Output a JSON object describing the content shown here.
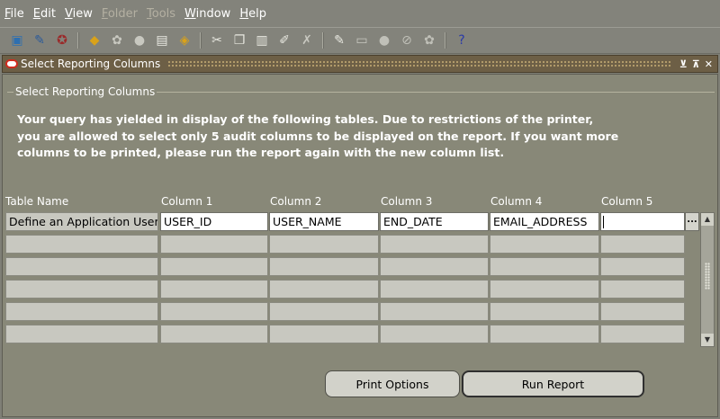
{
  "menubar": {
    "items": [
      {
        "ul": "F",
        "rest": "ile",
        "disabled": false
      },
      {
        "ul": "E",
        "rest": "dit",
        "disabled": false
      },
      {
        "ul": "V",
        "rest": "iew",
        "disabled": false
      },
      {
        "ul": "F",
        "rest": "older",
        "disabled": true
      },
      {
        "ul": "T",
        "rest": "ools",
        "disabled": true
      },
      {
        "ul": "W",
        "rest": "indow",
        "disabled": false
      },
      {
        "ul": "H",
        "rest": "elp",
        "disabled": false
      }
    ]
  },
  "toolbar": {
    "icons": [
      {
        "name": "new-record-icon",
        "glyph": "▣",
        "color": "#2e6fb0"
      },
      {
        "name": "find-icon",
        "glyph": "✎",
        "color": "#2a5a9a"
      },
      {
        "name": "navigator-icon",
        "glyph": "✪",
        "color": "#9a2a2a"
      },
      {
        "sep": true
      },
      {
        "name": "save-icon",
        "glyph": "◆",
        "color": "#d9a21a"
      },
      {
        "name": "next-step-icon",
        "glyph": "✿",
        "color": "#c8c8c0"
      },
      {
        "name": "switch-responsibility-icon",
        "glyph": "●",
        "color": "#c8c8c0"
      },
      {
        "name": "print-icon",
        "glyph": "▤",
        "color": "#eaeae2"
      },
      {
        "name": "close-form-icon",
        "glyph": "◈",
        "color": "#d9a21a"
      },
      {
        "sep": true
      },
      {
        "name": "cut-icon",
        "glyph": "✂",
        "color": "#e8e8e0"
      },
      {
        "name": "copy-icon",
        "glyph": "❐",
        "color": "#e8e8e0"
      },
      {
        "name": "paste-icon",
        "glyph": "▥",
        "color": "#e8e8e0"
      },
      {
        "name": "clear-record-icon",
        "glyph": "✐",
        "color": "#e8e8e0"
      },
      {
        "name": "delete-record-icon",
        "glyph": "✗",
        "color": "#c8c8c0"
      },
      {
        "sep": true
      },
      {
        "name": "edit-field-icon",
        "glyph": "✎",
        "color": "#eaeae2"
      },
      {
        "name": "zoom-icon",
        "glyph": "▭",
        "color": "#c8c8c0"
      },
      {
        "name": "translations-icon",
        "glyph": "●",
        "color": "#c0c0b8"
      },
      {
        "name": "attachments-icon",
        "glyph": "⊘",
        "color": "#c0c0b8"
      },
      {
        "name": "folder-tools-icon",
        "glyph": "✿",
        "color": "#c0c0b8"
      },
      {
        "sep": true
      },
      {
        "name": "help-icon",
        "glyph": "?",
        "color": "#2a3aa8"
      }
    ]
  },
  "window": {
    "title": "Select Reporting Columns",
    "controls": [
      "⊻",
      "⊼",
      "✕"
    ]
  },
  "form": {
    "group_label": "Select Reporting Columns",
    "notice_lines": [
      "Your query has yielded in display of the following tables.  Due to restrictions of the printer,",
      "you are allowed to select only 5 audit columns to be displayed on the report.  If you want more",
      "columns to be printed, please run the report again with the new column list."
    ],
    "headers": [
      "Table Name",
      "Column 1",
      "Column 2",
      "Column 3",
      "Column 4",
      "Column 5"
    ],
    "rows": [
      [
        "Define an Application User",
        "USER_ID",
        "USER_NAME",
        "END_DATE",
        "EMAIL_ADDRESS",
        ""
      ],
      [
        "",
        "",
        "",
        "",
        "",
        ""
      ],
      [
        "",
        "",
        "",
        "",
        "",
        ""
      ],
      [
        "",
        "",
        "",
        "",
        "",
        ""
      ],
      [
        "",
        "",
        "",
        "",
        "",
        ""
      ],
      [
        "",
        "",
        "",
        "",
        "",
        ""
      ]
    ],
    "lov_button": "...",
    "buttons": {
      "print_options": "Print Options",
      "run_report": "Run Report"
    }
  }
}
